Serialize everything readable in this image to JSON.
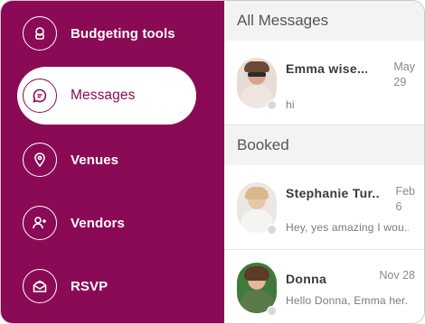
{
  "sidebar": {
    "items": [
      {
        "label": "Budgeting tools",
        "icon": "budget-icon"
      },
      {
        "label": "Messages",
        "icon": "chat-bubble-icon",
        "active": true
      },
      {
        "label": "Venues",
        "icon": "location-pin-icon"
      },
      {
        "label": "Vendors",
        "icon": "add-user-icon"
      },
      {
        "label": "RSVP",
        "icon": "envelope-icon"
      }
    ]
  },
  "panel": {
    "sections": [
      {
        "title": "All Messages",
        "messages": [
          {
            "name": "Emma wise...",
            "date_line1": "May",
            "date_line2": "29",
            "preview": "hi"
          }
        ]
      },
      {
        "title": "Booked",
        "messages": [
          {
            "name": "Stephanie Tur...",
            "date_line1": "Feb",
            "date_line2": "6",
            "preview": "Hey, yes amazing I wou..."
          },
          {
            "name": "Donna",
            "date_line1": "Nov 28",
            "date_line2": "",
            "preview": "Hello Donna, Emma her..."
          }
        ]
      }
    ]
  },
  "colors": {
    "brand": "#8b0a56",
    "header_bg": "#f3f3f3",
    "status_dot": "#d9d9d9"
  }
}
